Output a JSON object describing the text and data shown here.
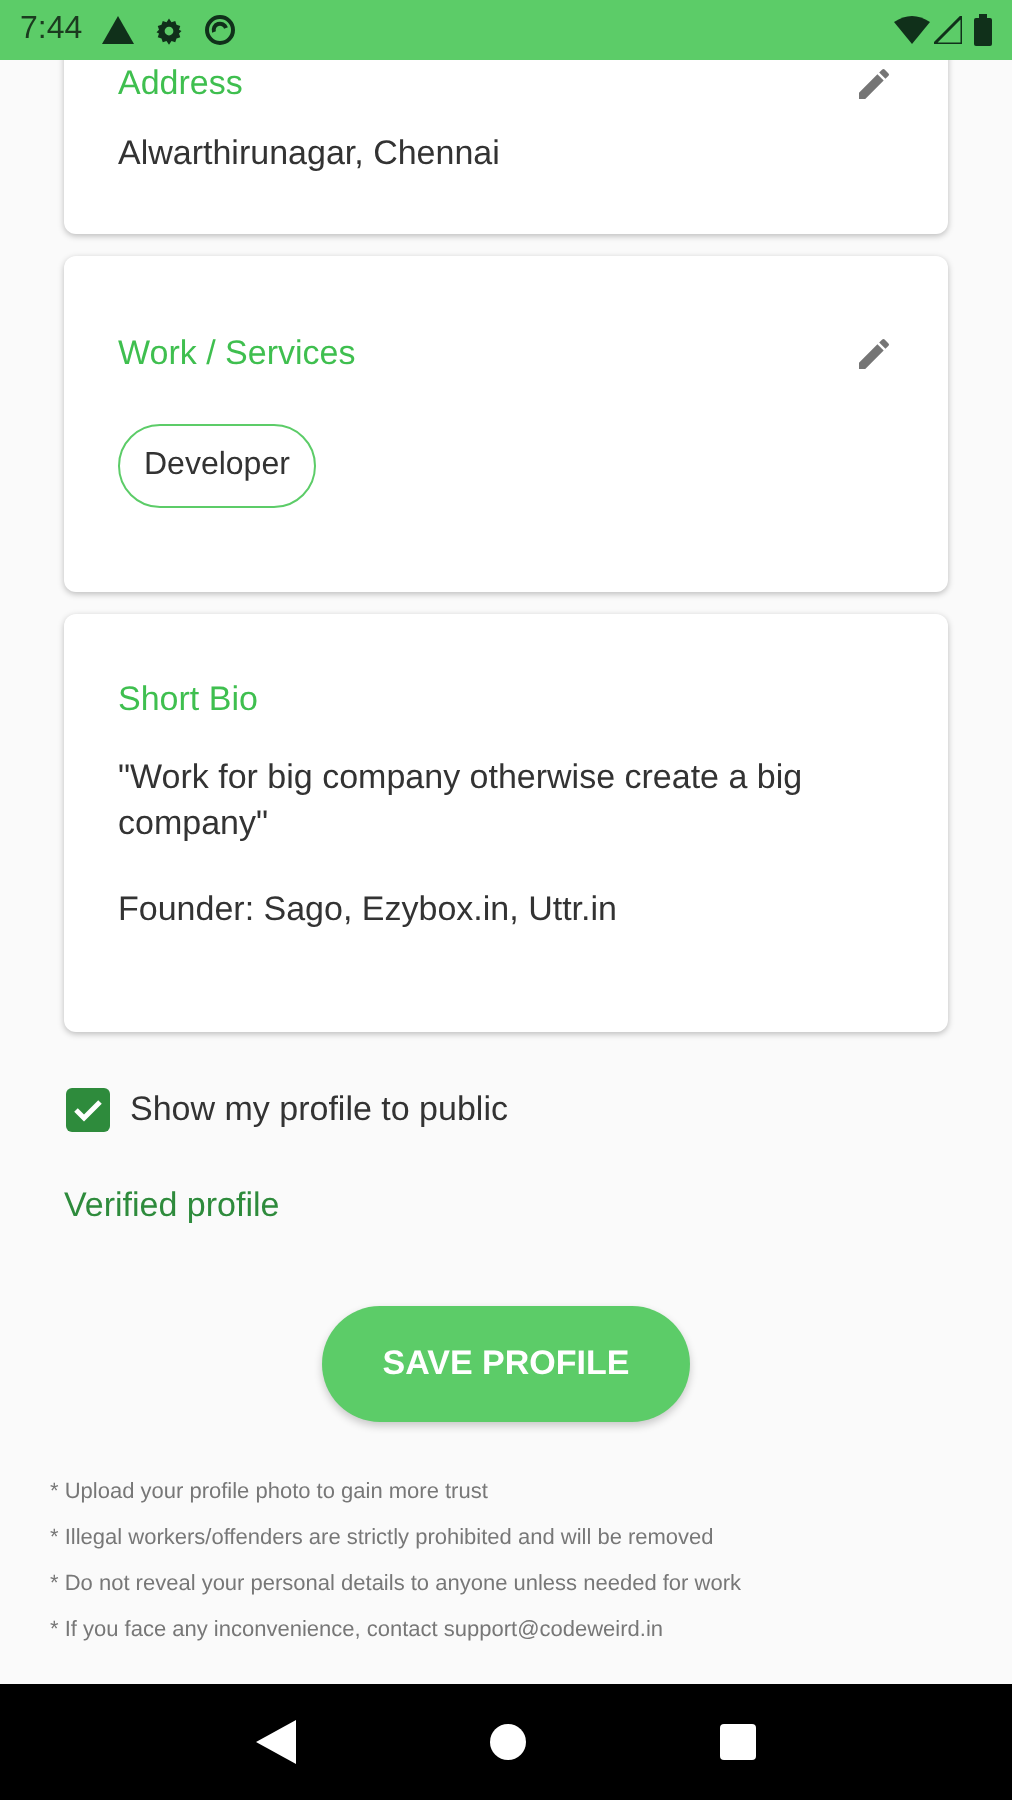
{
  "status_bar": {
    "time": "7:44"
  },
  "cards": [
    {
      "title": "Address",
      "editable": true,
      "kind": "text",
      "lines": [
        "Alwarthirunagar, Chennai"
      ]
    },
    {
      "title": "Work / Services",
      "editable": true,
      "kind": "chips",
      "chips": [
        "Developer"
      ]
    },
    {
      "title": "Short Bio",
      "editable": false,
      "kind": "text",
      "lines": [
        "\"Work for big company otherwise create a big company\"",
        "Founder: Sago, Ezybox.in, Uttr.in"
      ]
    }
  ],
  "public_checkbox": {
    "label": "Show my profile to public",
    "checked": true
  },
  "verified_label": "Verified profile",
  "save_button": "SAVE PROFILE",
  "notes": [
    "* Upload your profile photo to gain more trust",
    "* Illegal workers/offenders are strictly prohibited and will be removed",
    "* Do not reveal your personal details to anyone unless needed for work",
    "* If you face any inconvenience, contact support@codeweird.in"
  ]
}
